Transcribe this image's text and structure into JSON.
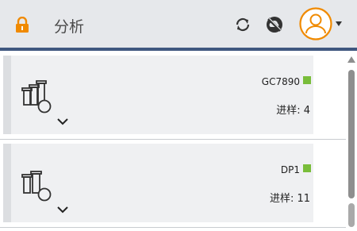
{
  "header": {
    "title": "分析",
    "icons": [
      "lock-icon",
      "refresh-icon",
      "no-cloud-icon",
      "user-avatar-icon",
      "caret-down-icon"
    ],
    "colors": {
      "accent": "#f08a00",
      "header_bg": "#e6e8eb",
      "header_border": "#3f577f"
    }
  },
  "instruments": [
    {
      "name": "GC7890",
      "status_color": "#79bd3a",
      "inject_label": "进样: 4"
    },
    {
      "name": "DP1",
      "status_color": "#79bd3a",
      "inject_label": "进样: 11"
    }
  ]
}
